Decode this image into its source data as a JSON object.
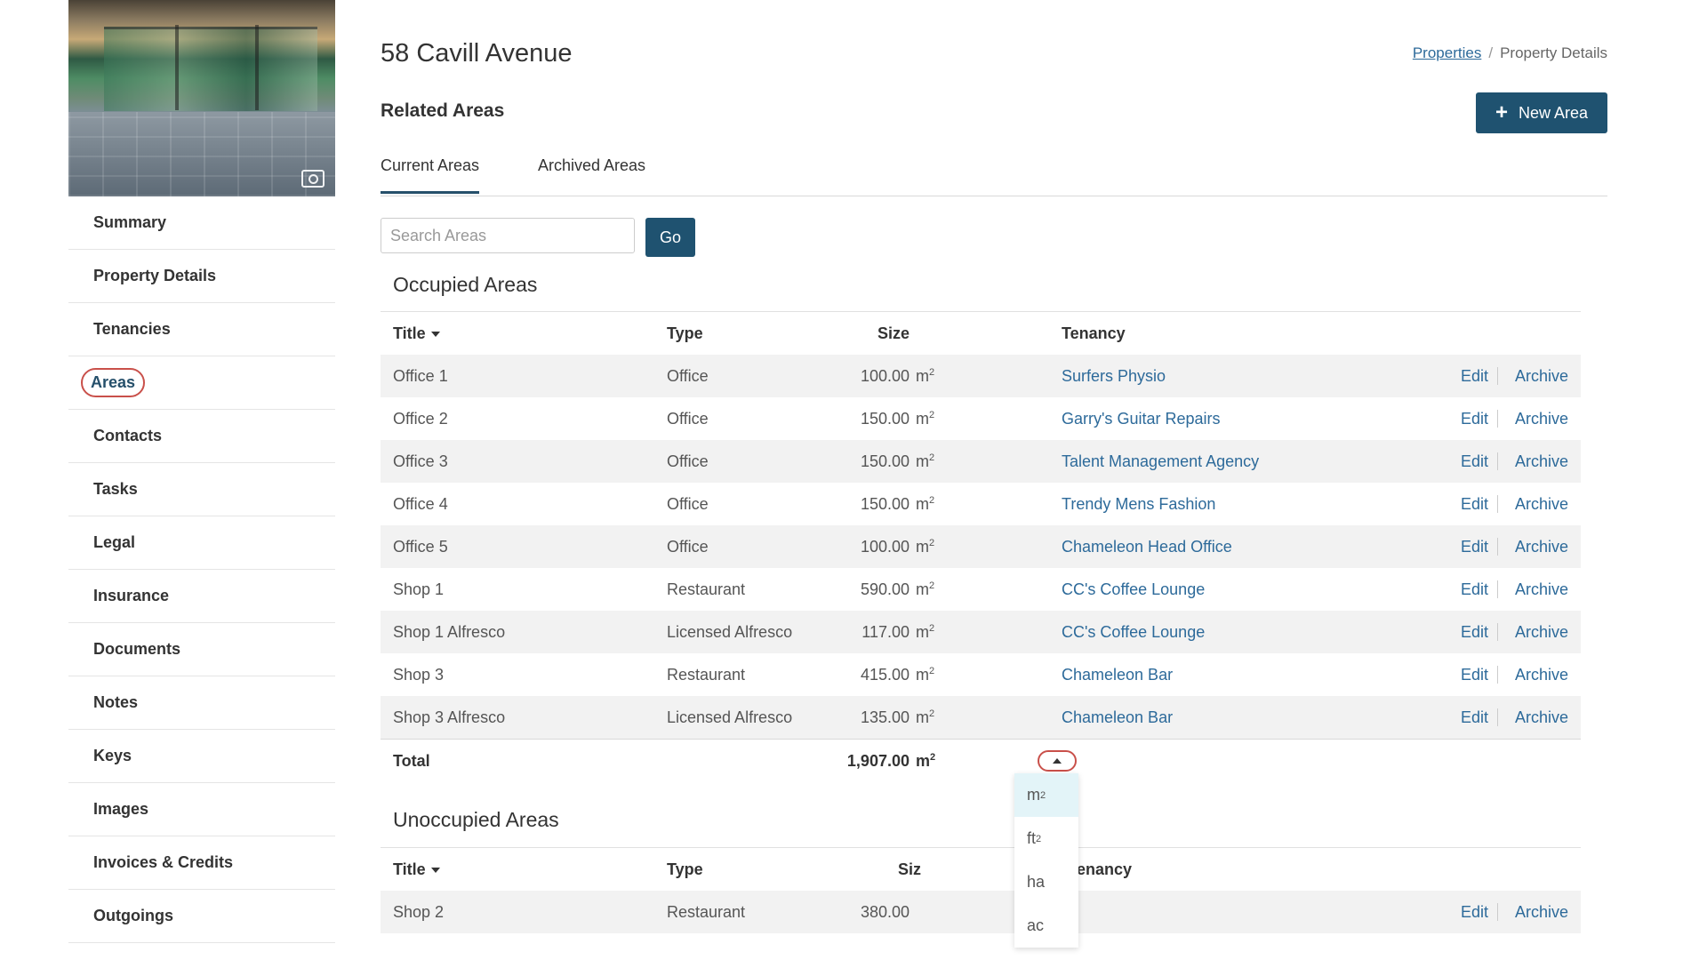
{
  "sidebar": {
    "items": [
      {
        "label": "Summary"
      },
      {
        "label": "Property Details"
      },
      {
        "label": "Tenancies"
      },
      {
        "label": "Areas"
      },
      {
        "label": "Contacts"
      },
      {
        "label": "Tasks"
      },
      {
        "label": "Legal"
      },
      {
        "label": "Insurance"
      },
      {
        "label": "Documents"
      },
      {
        "label": "Notes"
      },
      {
        "label": "Keys"
      },
      {
        "label": "Images"
      },
      {
        "label": "Invoices & Credits"
      },
      {
        "label": "Outgoings"
      }
    ],
    "active": "Areas"
  },
  "header": {
    "title": "58 Cavill Avenue",
    "breadcrumb": {
      "link": "Properties",
      "separator": "/",
      "current": "Property Details"
    },
    "section_title": "Related Areas",
    "new_button": {
      "icon": "plus-icon",
      "label": "New Area"
    }
  },
  "tabs": [
    {
      "label": "Current Areas",
      "active": true
    },
    {
      "label": "Archived Areas",
      "active": false
    }
  ],
  "search": {
    "placeholder": "Search Areas",
    "value": "",
    "go_label": "Go"
  },
  "columns": {
    "title": "Title",
    "type": "Type",
    "size": "Size",
    "tenancy": "Tenancy"
  },
  "actions": {
    "edit": "Edit",
    "archive": "Archive"
  },
  "occupied": {
    "heading": "Occupied Areas",
    "rows": [
      {
        "title": "Office 1",
        "type": "Office",
        "size": "100.00",
        "unit": "m",
        "tenancy": "Surfers Physio"
      },
      {
        "title": "Office 2",
        "type": "Office",
        "size": "150.00",
        "unit": "m",
        "tenancy": "Garry's Guitar Repairs"
      },
      {
        "title": "Office 3",
        "type": "Office",
        "size": "150.00",
        "unit": "m",
        "tenancy": "Talent Management Agency"
      },
      {
        "title": "Office 4",
        "type": "Office",
        "size": "150.00",
        "unit": "m",
        "tenancy": "Trendy Mens Fashion"
      },
      {
        "title": "Office 5",
        "type": "Office",
        "size": "100.00",
        "unit": "m",
        "tenancy": "Chameleon Head Office"
      },
      {
        "title": "Shop 1",
        "type": "Restaurant",
        "size": "590.00",
        "unit": "m",
        "tenancy": "CC's Coffee Lounge"
      },
      {
        "title": "Shop 1 Alfresco",
        "type": "Licensed Alfresco",
        "size": "117.00",
        "unit": "m",
        "tenancy": "CC's Coffee Lounge"
      },
      {
        "title": "Shop 3",
        "type": "Restaurant",
        "size": "415.00",
        "unit": "m",
        "tenancy": "Chameleon Bar"
      },
      {
        "title": "Shop 3 Alfresco",
        "type": "Licensed Alfresco",
        "size": "135.00",
        "unit": "m",
        "tenancy": "Chameleon Bar"
      }
    ],
    "total_label": "Total",
    "total_value": "1,907.00",
    "total_unit": "m"
  },
  "unit_superscript": "2",
  "unit_menu": {
    "options": [
      {
        "base": "m",
        "sup": "2"
      },
      {
        "base": "ft",
        "sup": "2"
      },
      {
        "base": "ha",
        "sup": ""
      },
      {
        "base": "ac",
        "sup": ""
      }
    ],
    "selected": "m"
  },
  "unoccupied": {
    "heading": "Unoccupied Areas",
    "header_size_visible": "Siz",
    "header_tenancy_visible": "enancy",
    "rows": [
      {
        "title": "Shop 2",
        "type": "Restaurant",
        "size": "380.00"
      }
    ]
  },
  "colors": {
    "primary": "#1f5270",
    "link": "#2d6a9a",
    "highlight": "#c9504a",
    "stripe": "#f2f2f2",
    "menu_selected": "#e3f4f8"
  }
}
